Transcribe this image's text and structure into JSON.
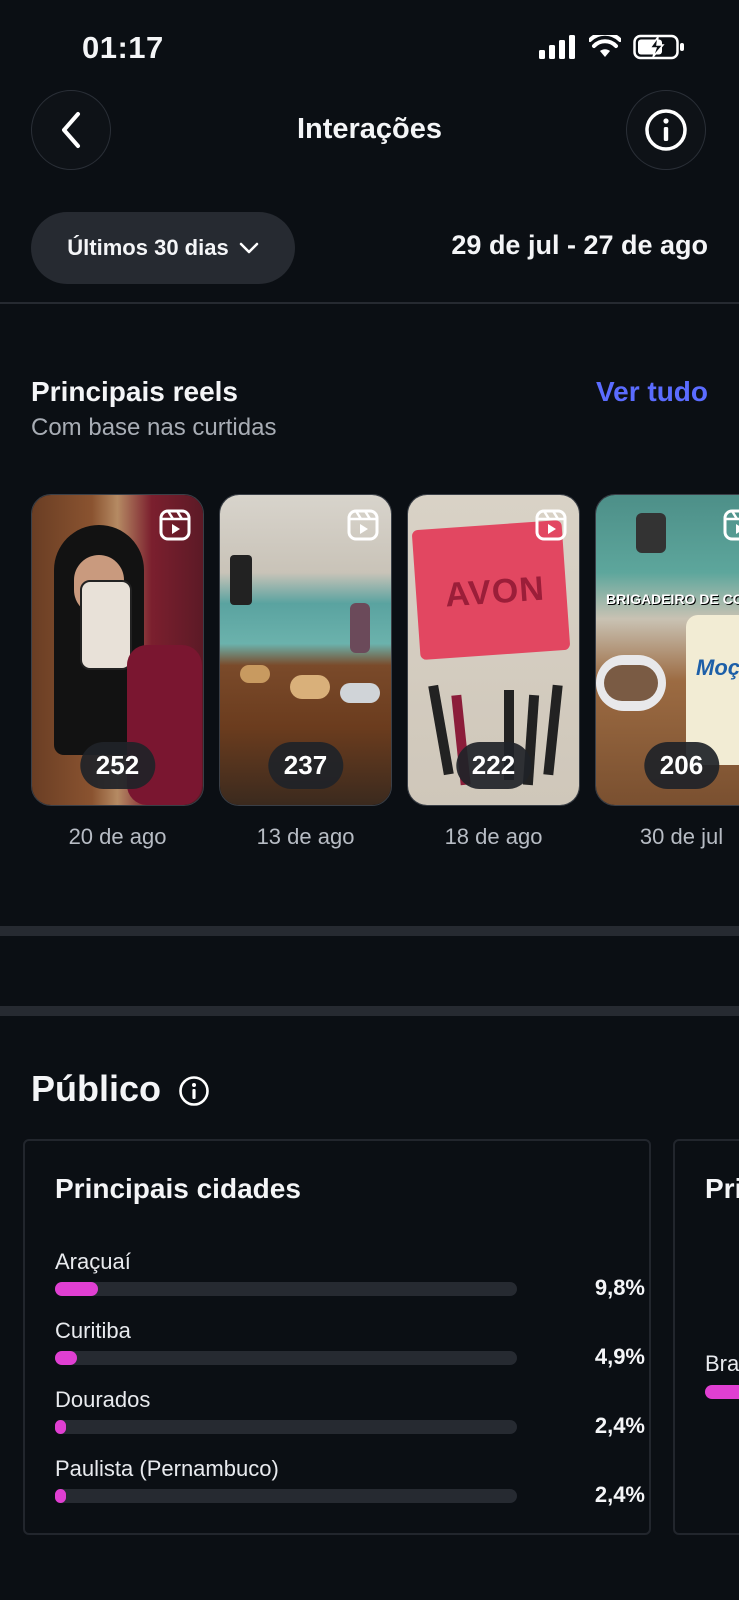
{
  "status": {
    "time": "01:17"
  },
  "header": {
    "title": "Interações"
  },
  "filter": {
    "period": "Últimos 30 dias",
    "date_range": "29 de jul - 27 de ago"
  },
  "reels": {
    "title": "Principais reels",
    "subtitle": "Com base nas curtidas",
    "see_all": "Ver tudo",
    "items": [
      {
        "count": "252",
        "date": "20 de ago"
      },
      {
        "count": "237",
        "date": "13 de ago"
      },
      {
        "count": "222",
        "date": "18 de ago",
        "thumb_text": "AVON"
      },
      {
        "count": "206",
        "date": "30 de jul",
        "thumb_text": "BRIGADEIRO DE COLH",
        "thumb_text2": "Moça"
      }
    ]
  },
  "audience": {
    "title": "Público",
    "cities_card": {
      "title": "Principais cidades",
      "rows": [
        {
          "label": "Araçuaí",
          "pct": "9,8%",
          "fraction": 0.098
        },
        {
          "label": "Curitiba",
          "pct": "4,9%",
          "fraction": 0.049
        },
        {
          "label": "Dourados",
          "pct": "2,4%",
          "fraction": 0.024
        },
        {
          "label": "Paulista (Pernambuco)",
          "pct": "2,4%",
          "fraction": 0.024
        }
      ]
    },
    "next_card": {
      "title": "Pri",
      "row_label": "Bra"
    }
  },
  "colors": {
    "accent_link": "#5b6cff",
    "bar_fill": "#e03fd2",
    "background": "#0b0f14"
  }
}
